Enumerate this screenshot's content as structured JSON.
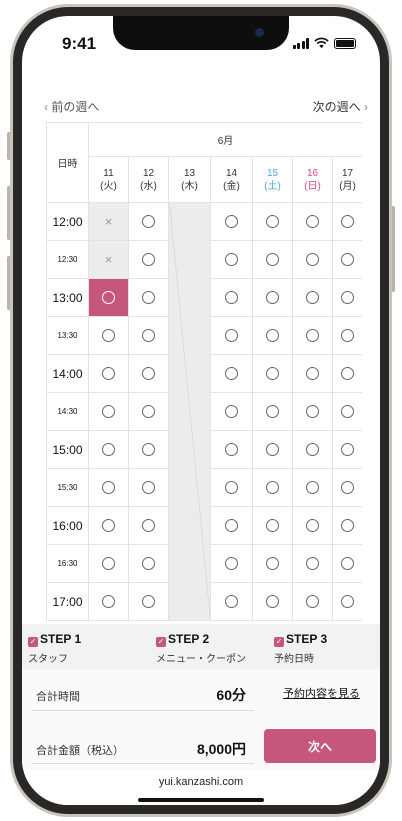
{
  "status": {
    "time": "9:41",
    "icons": [
      "signal-icon",
      "wifi-icon",
      "battery-icon"
    ]
  },
  "nav": {
    "prev_label": "前の週へ",
    "next_label": "次の週へ",
    "prev_icon": "chevron-left-icon",
    "next_icon": "chevron-right-icon"
  },
  "calendar": {
    "time_header": "日時",
    "month": "6月",
    "days": [
      {
        "date": "11",
        "weekday": "(火)",
        "kind": "weekday"
      },
      {
        "date": "12",
        "weekday": "(水)",
        "kind": "weekday"
      },
      {
        "date": "13",
        "weekday": "(木)",
        "kind": "weekday"
      },
      {
        "date": "14",
        "weekday": "(金)",
        "kind": "weekday"
      },
      {
        "date": "15",
        "weekday": "(土)",
        "kind": "saturday"
      },
      {
        "date": "16",
        "weekday": "(日)",
        "kind": "sunday"
      },
      {
        "date": "17",
        "weekday": "(月)",
        "kind": "weekday"
      }
    ],
    "closed_day_index": 2,
    "rows": [
      {
        "time": "12:00",
        "half": false,
        "slots": [
          "x",
          "o",
          "closed",
          "o",
          "o",
          "o",
          "o"
        ]
      },
      {
        "time": "12:30",
        "half": true,
        "slots": [
          "x",
          "o",
          "closed",
          "o",
          "o",
          "o",
          "o"
        ]
      },
      {
        "time": "13:00",
        "half": false,
        "slots": [
          "selected",
          "o",
          "closed",
          "o",
          "o",
          "o",
          "o"
        ]
      },
      {
        "time": "13:30",
        "half": true,
        "slots": [
          "o",
          "o",
          "closed",
          "o",
          "o",
          "o",
          "o"
        ]
      },
      {
        "time": "14:00",
        "half": false,
        "slots": [
          "o",
          "o",
          "closed",
          "o",
          "o",
          "o",
          "o"
        ]
      },
      {
        "time": "14:30",
        "half": true,
        "slots": [
          "o",
          "o",
          "closed",
          "o",
          "o",
          "o",
          "o"
        ]
      },
      {
        "time": "15:00",
        "half": false,
        "slots": [
          "o",
          "o",
          "closed",
          "o",
          "o",
          "o",
          "o"
        ]
      },
      {
        "time": "15:30",
        "half": true,
        "slots": [
          "o",
          "o",
          "closed",
          "o",
          "o",
          "o",
          "o"
        ]
      },
      {
        "time": "16:00",
        "half": false,
        "slots": [
          "o",
          "o",
          "closed",
          "o",
          "o",
          "o",
          "o"
        ]
      },
      {
        "time": "16:30",
        "half": true,
        "slots": [
          "o",
          "o",
          "closed",
          "o",
          "o",
          "o",
          "o"
        ]
      },
      {
        "time": "17:00",
        "half": false,
        "slots": [
          "o",
          "o",
          "closed",
          "o",
          "o",
          "o",
          "o"
        ]
      }
    ],
    "symbols": {
      "available": "○",
      "unavailable": "×"
    }
  },
  "steps": [
    {
      "title": "STEP 1",
      "subtitle": "スタッフ",
      "icon": "check-icon"
    },
    {
      "title": "STEP 2",
      "subtitle": "メニュー・クーポン",
      "icon": "check-icon"
    },
    {
      "title": "STEP 3",
      "subtitle": "予約日時",
      "icon": "check-icon"
    }
  ],
  "summary": {
    "total_time_label": "合計時間",
    "total_time_value": "60分",
    "total_price_label": "合計金額（税込）",
    "total_price_value": "8,000円",
    "view_details_label": "予約内容を見る",
    "next_button_label": "次へ"
  },
  "browser": {
    "url": "yui.kanzashi.com"
  },
  "colors": {
    "accent": "#c4577b",
    "saturday": "#4aa8d8",
    "sunday": "#d9468c",
    "unavailable_bg": "#ececec"
  }
}
